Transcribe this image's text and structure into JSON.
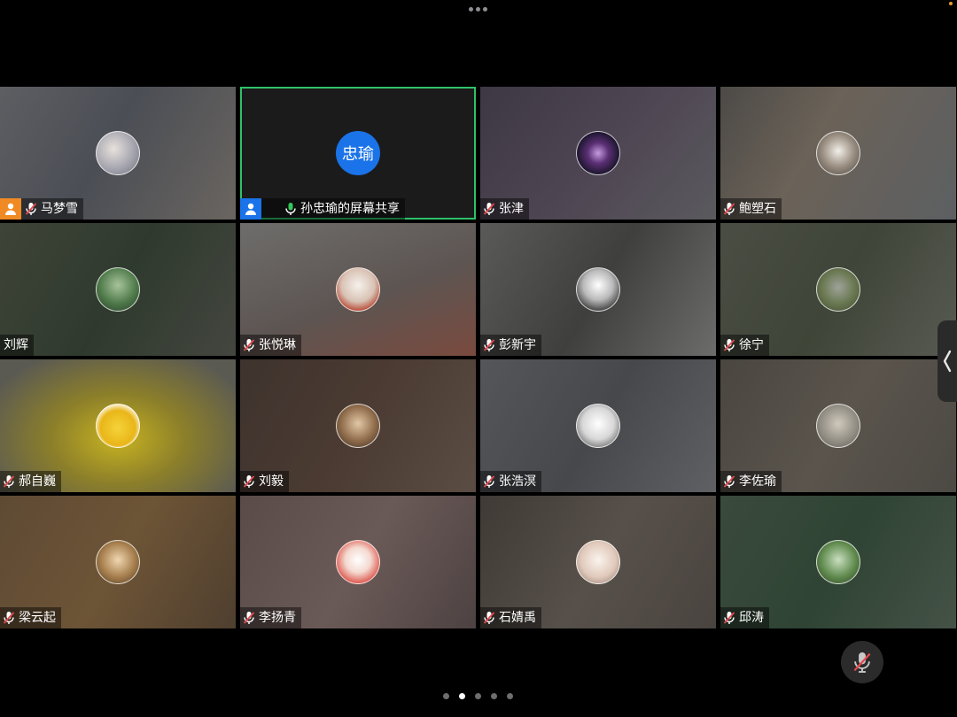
{
  "window": {
    "corner_indicator_color": "#e89c2c"
  },
  "participants": [
    {
      "name": "马梦雪",
      "muted": true,
      "host_badge": "orange"
    },
    {
      "name": "孙忠瑜的屏幕共享",
      "muted": false,
      "share": true,
      "avatar_text": "忠瑜",
      "active": true
    },
    {
      "name": "张津",
      "muted": true
    },
    {
      "name": "鲍塑石",
      "muted": true
    },
    {
      "name": "刘辉",
      "muted": null
    },
    {
      "name": "张悦琳",
      "muted": true
    },
    {
      "name": "彭新宇",
      "muted": true
    },
    {
      "name": "徐宁",
      "muted": true
    },
    {
      "name": "郝自巍",
      "muted": true
    },
    {
      "name": "刘毅",
      "muted": true
    },
    {
      "name": "张浩溟",
      "muted": true
    },
    {
      "name": "李佐瑜",
      "muted": true
    },
    {
      "name": "梁云起",
      "muted": true
    },
    {
      "name": "李扬青",
      "muted": true
    },
    {
      "name": "石婧禹",
      "muted": true
    },
    {
      "name": "邱涛",
      "muted": true
    }
  ],
  "icons": {
    "mic_muted": "mic-muted-icon",
    "mic_on": "mic-icon",
    "host": "user-icon",
    "side_handle": "chevron-left-icon",
    "floating": "mic-muted-icon"
  },
  "colors": {
    "active_border": "#2fc26a",
    "avatar_blue": "#1a73e8",
    "mic_on_green": "#34c759",
    "mic_muted_red": "#e5484d",
    "host_orange": "#f08a24",
    "host_blue": "#1a73e8"
  },
  "pager": {
    "count": 5,
    "current": 2
  }
}
